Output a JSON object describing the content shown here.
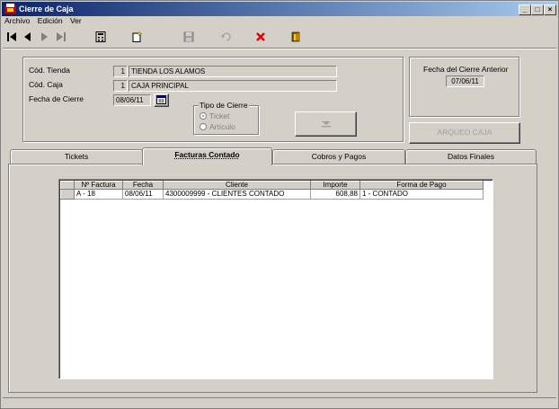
{
  "window": {
    "title": "Cierre de Caja",
    "controls": [
      "_",
      "□",
      "×"
    ]
  },
  "menu": [
    "Archivo",
    "Edición",
    "Ver"
  ],
  "header": {
    "tienda_label": "Cód. Tienda",
    "tienda_code": "1",
    "tienda_name": "TIENDA LOS ALAMOS",
    "caja_label": "Cód. Caja",
    "caja_code": "1",
    "caja_name": "CAJA PRINCIPAL",
    "fecha_label": "Fecha de Cierre",
    "fecha_value": "08/06/11",
    "tipo_label": "Tipo de Cierre",
    "tipo_options": [
      "Ticket",
      "Artículo"
    ],
    "anterior_label": "Fecha del Cierre Anterior",
    "anterior_value": "07/06/11",
    "arqueo_button": "ARQUEO CAJA"
  },
  "tabs": [
    "Tickets",
    "Facturas Contado",
    "Cobros y Pagos",
    "Datos Finales"
  ],
  "table": {
    "columns": [
      "Nº Factura",
      "Fecha",
      "Cliente",
      "Importe",
      "Forma de Pago"
    ],
    "rows": [
      [
        "A - 18",
        "08/06/11",
        "4300009999 - CLIENTES CONTADO",
        "608,88",
        "1 - CONTADO"
      ]
    ]
  }
}
